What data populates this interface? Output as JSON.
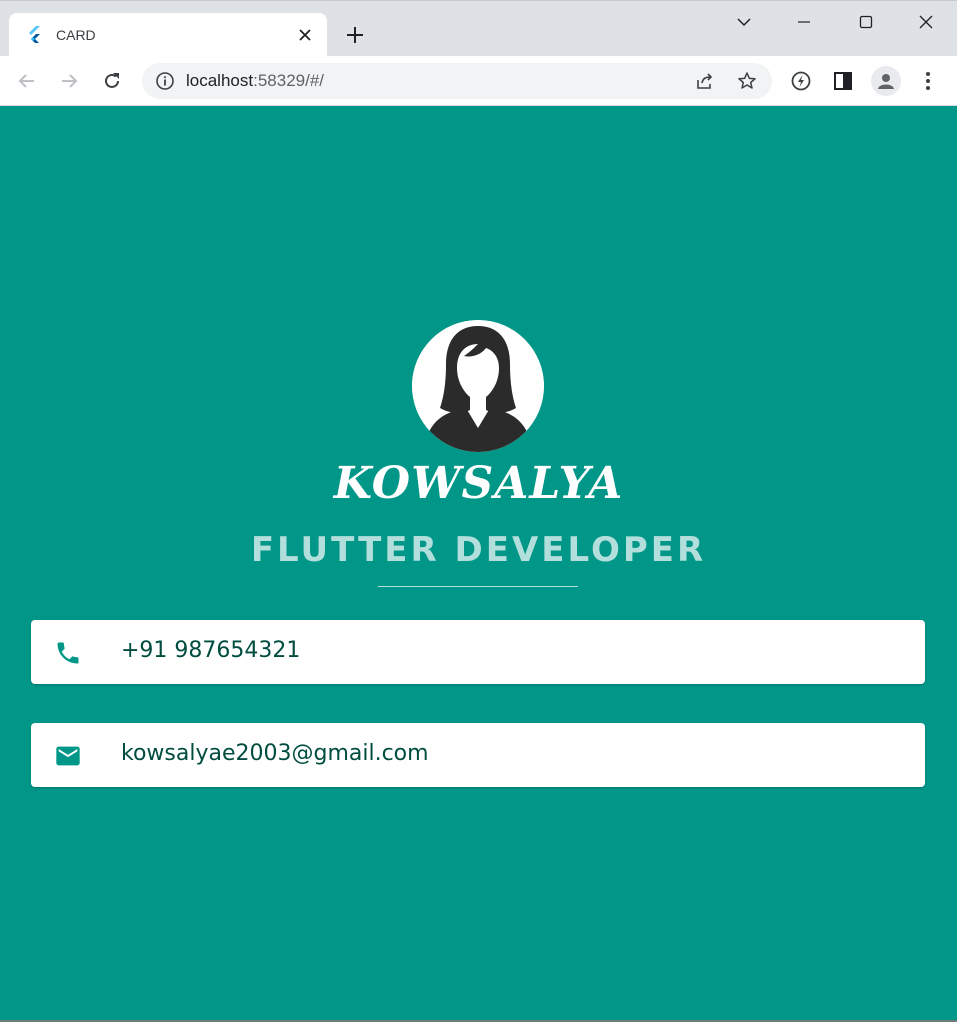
{
  "browser": {
    "tab_title": "CARD",
    "url_host": "localhost",
    "url_rest": ":58329/#/"
  },
  "profile": {
    "name": "KOWSALYA",
    "title": "FLUTTER DEVELOPER",
    "phone": "+91 987654321",
    "email": "kowsalyae2003@gmail.com"
  },
  "colors": {
    "background": "#009688",
    "card": "#ffffff",
    "card_text": "#004d40",
    "subtitle": "#b2dfdb"
  }
}
